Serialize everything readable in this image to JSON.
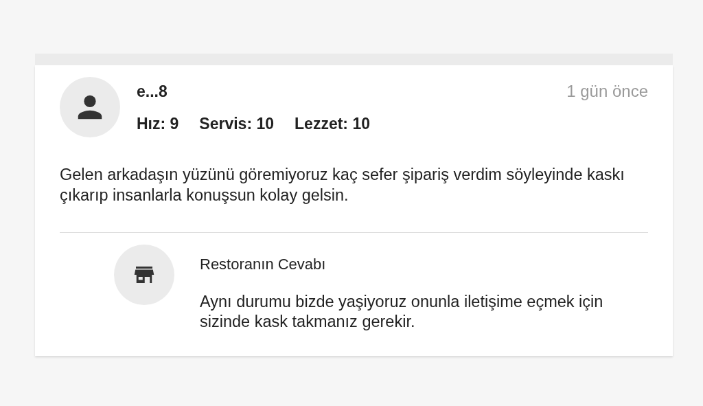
{
  "review": {
    "author": "e...8",
    "time": "1 gün önce",
    "ratings": [
      "Hız: 9",
      "Servis: 10",
      "Lezzet: 10"
    ],
    "comment": "Gelen arkadaşın yüzünü göremiyoruz kaç sefer şipariş verdim söyleyinde kaskı çıkarıp insanlarla konuşsun kolay gelsin."
  },
  "reply": {
    "title": "Restoranın Cevabı",
    "text": "Aynı durumu bizde yaşiyoruz onunla iletişime eçmek için sizinde kask takmanız gerekir."
  }
}
